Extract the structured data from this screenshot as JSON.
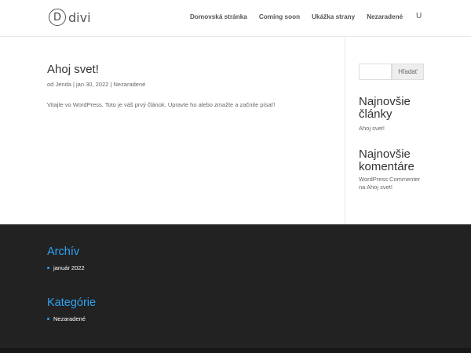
{
  "header": {
    "logo_letter": "D",
    "logo_text": "divi",
    "nav": [
      "Domovská stránka",
      "Coming soon",
      "Ukážka strany",
      "Nezaradené"
    ],
    "search_icon_glyph": "U"
  },
  "post": {
    "title": "Ahoj svet!",
    "meta_prefix": "od",
    "author": "Jenda",
    "separator1": "|",
    "date": "jan 30, 2022",
    "separator2": "|",
    "category": "Nezaradené",
    "excerpt": "Vitajte vo WordPress. Toto je váš prvý článok. Upravte ho alebo zmažte a začnite písať!"
  },
  "sidebar": {
    "search_button": "Hľadať",
    "recent_posts_title_1": "Najnovšie",
    "recent_posts_title_2": "články",
    "recent_post_1": "Ahoj svet!",
    "recent_comments_title_1": "Najnovšie",
    "recent_comments_title_2": "komentáre",
    "comment_1": "WordPress Commenter na Ahoj svet!"
  },
  "footer": {
    "archive_title": "Archív",
    "archive_item": "január 2022",
    "categories_title": "Kategórie",
    "category_item": "Nezaradené"
  },
  "colors": {
    "accent": "#2ea3f2",
    "footer_bg": "#222222"
  }
}
